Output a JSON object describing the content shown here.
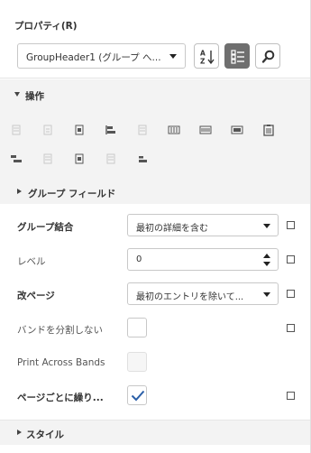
{
  "panel": {
    "title": "プロパティ(R)",
    "component_selector": {
      "value": "GroupHeader1 (グループ へ..."
    },
    "toolbar": {
      "sort_icon": "sort-alphabetical-icon",
      "categorized_icon": "categorized-icon",
      "search_icon": "search-icon"
    }
  },
  "sections": {
    "operations": "操作",
    "group_fields": "グループ フィールド",
    "style": "スタイル"
  },
  "properties": {
    "group_join": {
      "label": "グループ結合",
      "value": "最初の詳細を含む"
    },
    "level": {
      "label": "レベル",
      "value": "0"
    },
    "page_break": {
      "label": "改ページ",
      "value": "最初のエントリを除いて..."
    },
    "keep_together": {
      "label": "バンドを分割しない",
      "checked": false
    },
    "print_across_bands": {
      "label": "Print Across Bands",
      "checked": false,
      "disabled": true
    },
    "repeat_each_page": {
      "label": "ページごとに繰り...",
      "checked": true
    }
  },
  "colors": {
    "accent": "#2b5fa8",
    "section_bg": "#f3f3f3",
    "active_toggle": "#6f6f6f"
  }
}
